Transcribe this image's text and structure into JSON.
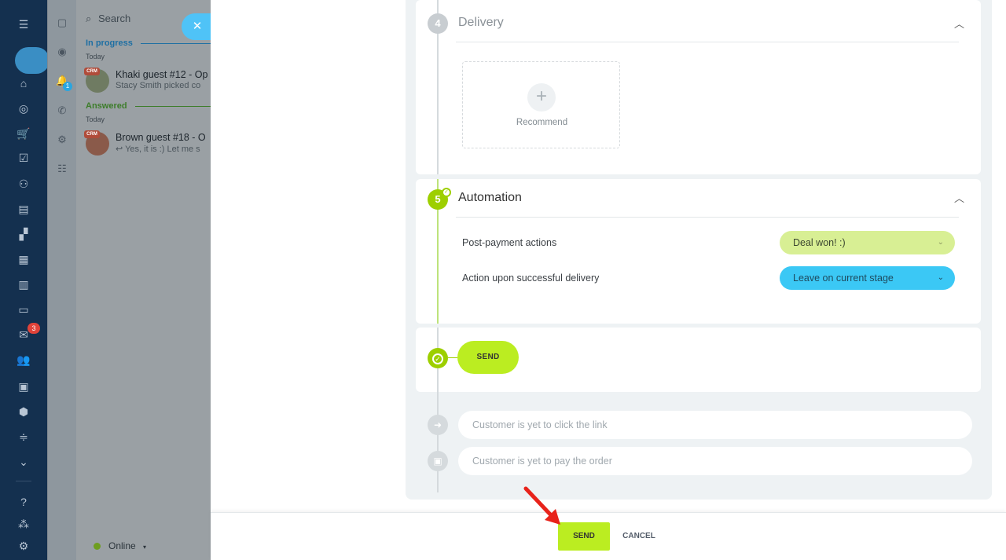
{
  "left_sidebar": {
    "mail_badge": "3"
  },
  "strip": {
    "notification_badge": "1"
  },
  "chat_panel": {
    "search_placeholder": "Search",
    "sections": [
      {
        "label": "In progress",
        "day": "Today",
        "color": "#1e6fa3"
      },
      {
        "label": "Answered",
        "day": "Today",
        "color": "#3d7d2a"
      }
    ],
    "chats": [
      {
        "crm": "CRM",
        "name": "Khaki guest #12 - Op",
        "preview": "Stacy Smith picked co",
        "avatar_color": "#6f7b62"
      },
      {
        "crm": "CRM",
        "name": "Brown guest #18 - O",
        "preview": "Yes, it is :) Let me s",
        "avatar_color": "#8a5a4a"
      }
    ],
    "status": "Online"
  },
  "delivery": {
    "step": "4",
    "title": "Delivery",
    "recommend_label": "Recommend"
  },
  "automation": {
    "step": "5",
    "title": "Automation",
    "rows": [
      {
        "label": "Post-payment actions",
        "value": "Deal won! :)",
        "bg": "#d8ef94",
        "fg": "#3b4630"
      },
      {
        "label": "Action upon successful delivery",
        "value": "Leave on current stage",
        "bg": "#3bc8f5",
        "fg": "#1e4a5e"
      }
    ]
  },
  "send_block": {
    "label": "SEND"
  },
  "statuses": [
    {
      "icon": "arrow-right-icon",
      "text": "Customer is yet to click the link"
    },
    {
      "icon": "wallet-icon",
      "text": "Customer is yet to pay the order"
    }
  ],
  "footer": {
    "send_label": "SEND",
    "cancel_label": "CANCEL"
  },
  "colors": {
    "accent_green": "#bbed21",
    "accent_blue": "#3bc8f5"
  }
}
